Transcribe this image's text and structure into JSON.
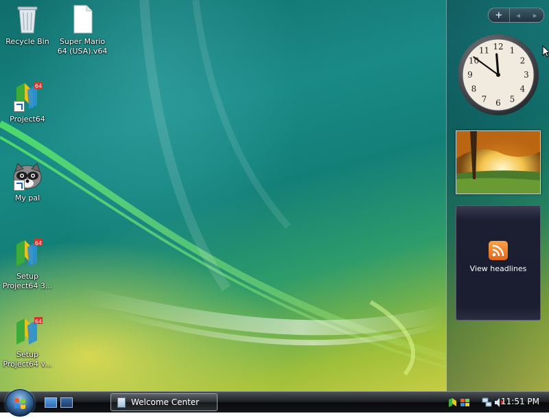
{
  "desktop": {
    "icons": [
      {
        "label": "Recycle Bin",
        "icon": "recycle-bin-icon"
      },
      {
        "label": "Super Mario 64 (USA).v64",
        "icon": "file-icon"
      },
      {
        "label": "Project64",
        "icon": "project64-icon"
      },
      {
        "label": "My pal",
        "icon": "raccoon-icon"
      },
      {
        "label": "Setup Project64 3...",
        "icon": "project64-setup-icon"
      },
      {
        "label": "Setup Project64 v...",
        "icon": "project64-setup-icon"
      }
    ]
  },
  "sidebar": {
    "controls": {
      "add": "+",
      "prev": "◂",
      "next": "▸"
    },
    "clock": {
      "hour": 11,
      "minute": 51,
      "numerals": [
        "12",
        "1",
        "2",
        "3",
        "4",
        "5",
        "6",
        "7",
        "8",
        "9",
        "10",
        "11"
      ]
    },
    "slideshow": {
      "icon": "landscape-photo"
    },
    "feed": {
      "label": "View headlines",
      "icon": "rss-icon"
    }
  },
  "taskbar": {
    "start": {
      "icon": "windows-start-orb-icon"
    },
    "quick_launch": [
      {
        "icon": "show-desktop-icon"
      },
      {
        "icon": "switch-windows-icon"
      }
    ],
    "window_button": {
      "label": "Welcome Center",
      "icon": "window-icon"
    },
    "tray": {
      "icons": [
        "project64-tray-icon",
        "flag-tray-icon",
        "network-icon",
        "volume-muted-icon"
      ],
      "time": "11:51 PM"
    }
  },
  "colors": {
    "wallpaper_teal": "#138078",
    "wallpaper_yellow": "#d9d248",
    "taskbar_dark": "#131619",
    "rss_orange": "#e0661a"
  }
}
